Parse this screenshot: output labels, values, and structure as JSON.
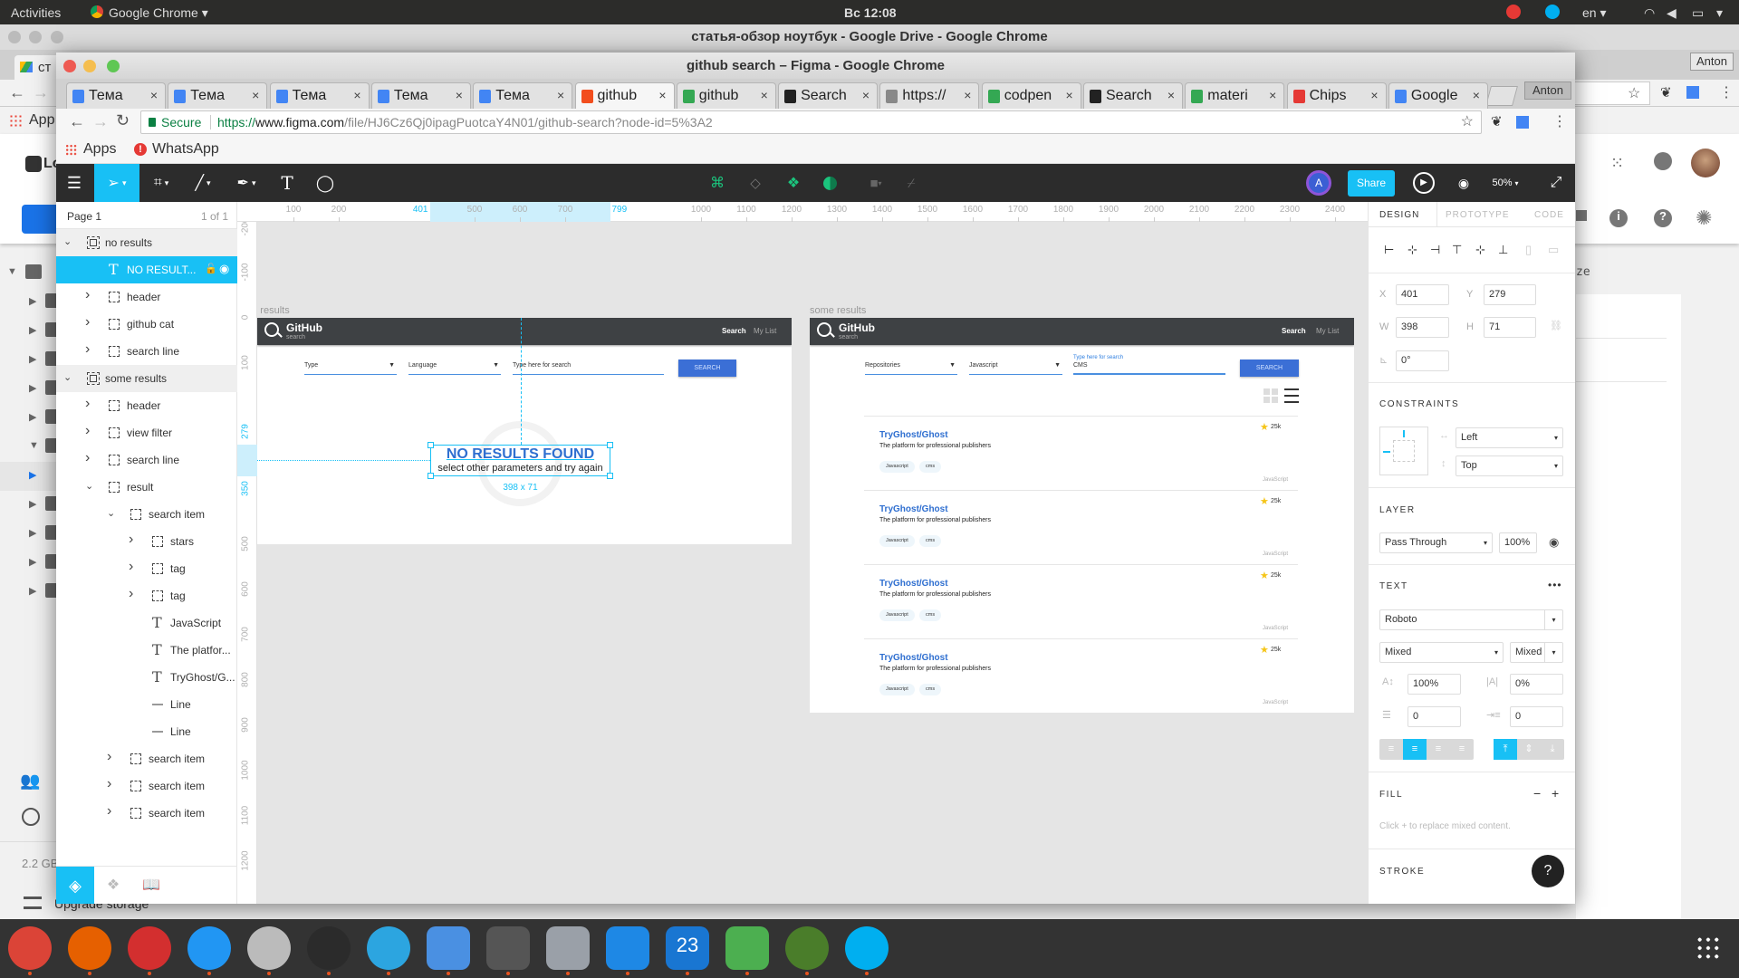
{
  "os": {
    "activities": "Activities",
    "app_menu": "Google Chrome ▾",
    "clock": "Вс 12:08",
    "lang": "en ▾"
  },
  "bg_window": {
    "title": "статья-обзор ноутбук - Google Drive - Google Chrome",
    "tab": "ст",
    "profile": "Anton",
    "apps": "App",
    "drive_logo": "Lo",
    "storage": "2.2 GB",
    "upgrade": "Upgrade storage",
    "right_label": "ze"
  },
  "window": {
    "title": "github search – Figma - Google Chrome",
    "tabs": [
      {
        "label": "Тема",
        "icon": "docs-icon",
        "color": "#4285f4"
      },
      {
        "label": "Тема",
        "icon": "docs-icon",
        "color": "#4285f4"
      },
      {
        "label": "Тема",
        "icon": "docs-icon",
        "color": "#4285f4"
      },
      {
        "label": "Тема",
        "icon": "docs-icon",
        "color": "#4285f4"
      },
      {
        "label": "Тема",
        "icon": "docs-icon",
        "color": "#4285f4"
      },
      {
        "label": "github",
        "icon": "figma-icon",
        "color": "#f24e1e",
        "active": true
      },
      {
        "label": "github",
        "icon": "google-icon",
        "color": "#34a853"
      },
      {
        "label": "Search",
        "icon": "github-icon",
        "color": "#222222"
      },
      {
        "label": "https://",
        "icon": "page-icon",
        "color": "#888888"
      },
      {
        "label": "codpen",
        "icon": "google-icon",
        "color": "#34a853"
      },
      {
        "label": "Search",
        "icon": "github-icon",
        "color": "#222222"
      },
      {
        "label": "materi",
        "icon": "google-icon",
        "color": "#34a853"
      },
      {
        "label": "Chips",
        "icon": "chips-icon",
        "color": "#e53935"
      },
      {
        "label": "Google",
        "icon": "translate-icon",
        "color": "#4285f4"
      }
    ],
    "profile": "Anton",
    "secure": "Secure",
    "url": {
      "scheme": "https://",
      "host": "www.figma.com",
      "path": "/file/HJ6Cz6Qj0ipagPuotcaY4N01/github-search?node-id=5%3A2"
    },
    "bookmarks": [
      {
        "label": "Apps"
      },
      {
        "label": "WhatsApp"
      }
    ]
  },
  "figma": {
    "toolbar": {
      "zoom": "50%",
      "share": "Share",
      "avatar": "A",
      "accent": "#18c0f5"
    },
    "page": {
      "name": "Page 1",
      "count": "1 of 1"
    },
    "layers": [
      {
        "label": "no results",
        "level": 0,
        "kind": "frame",
        "chevron": "down",
        "group": true
      },
      {
        "label": "NO RESULT...",
        "level": 1,
        "kind": "text",
        "selected": true
      },
      {
        "label": "header",
        "level": 1,
        "kind": "group",
        "chevron": "right"
      },
      {
        "label": "github cat",
        "level": 1,
        "kind": "group",
        "chevron": "right"
      },
      {
        "label": "search line",
        "level": 1,
        "kind": "group",
        "chevron": "right"
      },
      {
        "label": "some results",
        "level": 0,
        "kind": "frame",
        "chevron": "down",
        "group": true
      },
      {
        "label": "header",
        "level": 1,
        "kind": "group",
        "chevron": "right"
      },
      {
        "label": "view filter",
        "level": 1,
        "kind": "group",
        "chevron": "right"
      },
      {
        "label": "search line",
        "level": 1,
        "kind": "group",
        "chevron": "right"
      },
      {
        "label": "result",
        "level": 1,
        "kind": "group",
        "chevron": "down"
      },
      {
        "label": "search item",
        "level": 2,
        "kind": "group",
        "chevron": "down"
      },
      {
        "label": "stars",
        "level": 3,
        "kind": "group",
        "chevron": "right"
      },
      {
        "label": "tag",
        "level": 3,
        "kind": "group",
        "chevron": "right"
      },
      {
        "label": "tag",
        "level": 3,
        "kind": "group",
        "chevron": "right"
      },
      {
        "label": "JavaScript",
        "level": 3,
        "kind": "text"
      },
      {
        "label": "The platfor...",
        "level": 3,
        "kind": "text"
      },
      {
        "label": "TryGhost/G...",
        "level": 3,
        "kind": "text"
      },
      {
        "label": "Line",
        "level": 3,
        "kind": "line"
      },
      {
        "label": "Line",
        "level": 3,
        "kind": "line"
      },
      {
        "label": "search item",
        "level": 2,
        "kind": "group",
        "chevron": "right"
      },
      {
        "label": "search item",
        "level": 2,
        "kind": "group",
        "chevron": "right"
      },
      {
        "label": "search item",
        "level": 2,
        "kind": "group",
        "chevron": "right"
      }
    ],
    "rulers": {
      "h_ticks": [
        100,
        200,
        500,
        600,
        700,
        1000,
        1100,
        1200,
        1300,
        1400,
        1500,
        1600,
        1700,
        1800,
        1900,
        2000,
        2100,
        2200,
        2300,
        2400
      ],
      "h_sel": [
        401,
        799
      ],
      "v_ticks": [
        -200,
        -100,
        0,
        100,
        500,
        600,
        700,
        800,
        900,
        1000,
        1100,
        1200
      ],
      "v_sel": [
        279,
        350
      ]
    },
    "frame_no_results": {
      "label": "no results",
      "brand": "GitHub",
      "brand_sub": "search",
      "nav": [
        "Search",
        "My List"
      ],
      "filters": [
        "Type",
        "Language"
      ],
      "search_placeholder": "Type here for search",
      "button": "SEARCH",
      "empty_title": "NO RESULTS FOUND",
      "empty_subtitle": "select other parameters and try again",
      "selection_size": "398 x 71"
    },
    "frame_some_results": {
      "label": "some results",
      "brand": "GitHub",
      "brand_sub": "search",
      "nav": [
        "Search",
        "My List"
      ],
      "filters": [
        "Repositories",
        "Javascript"
      ],
      "search_label": "Type here for search",
      "search_value": "CMS",
      "button": "SEARCH",
      "results": [
        {
          "title": "TryGhost/Ghost",
          "description": "The platform for professional publishers",
          "tags": [
            "Javascript",
            "cms"
          ],
          "stars": "25k",
          "language": "JavaScript"
        },
        {
          "title": "TryGhost/Ghost",
          "description": "The platform for professional publishers",
          "tags": [
            "Javascript",
            "cms"
          ],
          "stars": "25k",
          "language": "JavaScript"
        },
        {
          "title": "TryGhost/Ghost",
          "description": "The platform for professional publishers",
          "tags": [
            "Javascript",
            "cms"
          ],
          "stars": "25k",
          "language": "JavaScript"
        },
        {
          "title": "TryGhost/Ghost",
          "description": "The platform for professional publishers",
          "tags": [
            "Javascript",
            "cms"
          ],
          "stars": "25k",
          "language": "JavaScript"
        }
      ]
    },
    "panel": {
      "tabs": [
        "DESIGN",
        "PROTOTYPE",
        "CODE"
      ],
      "x": "401",
      "y": "279",
      "w": "398",
      "h": "71",
      "rotation": "0°",
      "labels": {
        "x": "X",
        "y": "Y",
        "w": "W",
        "h": "H"
      },
      "constraints_title": "CONSTRAINTS",
      "constraint_h": "Left",
      "constraint_v": "Top",
      "layer_title": "LAYER",
      "blend": "Pass Through",
      "opacity": "100%",
      "text_title": "TEXT",
      "font": "Roboto",
      "weight": "Mixed",
      "size": "Mixed",
      "line_height": "100%",
      "letter_spacing": "0%",
      "para_spacing": "0",
      "indent": "0",
      "fill_title": "FILL",
      "fill_hint": "Click + to replace mixed content.",
      "stroke_title": "STROKE",
      "help": "?"
    }
  },
  "dock": [
    {
      "icon": "chrome-icon",
      "color": "#db4437"
    },
    {
      "icon": "firefox-icon",
      "color": "#e66000"
    },
    {
      "icon": "music-icon",
      "color": "#d32f2f"
    },
    {
      "icon": "finder-icon",
      "color": "#2196f3"
    },
    {
      "icon": "software-install-icon",
      "color": "#bbbbbb"
    },
    {
      "icon": "terminal-icon",
      "color": "#2b2b2b"
    },
    {
      "icon": "telegram-icon",
      "color": "#2ca5e0"
    },
    {
      "icon": "image-viewer-icon",
      "color": "#4a90e2"
    },
    {
      "icon": "settings-icon",
      "color": "#555555"
    },
    {
      "icon": "inkscape-icon",
      "color": "#9aa0a8"
    },
    {
      "icon": "vscode-icon",
      "color": "#1e88e5"
    },
    {
      "icon": "calendar-icon",
      "color": "#1976d2",
      "label": "23"
    },
    {
      "icon": "sublime-icon",
      "color": "#4caf50"
    },
    {
      "icon": "keepass-icon",
      "color": "#4a7d2a"
    },
    {
      "icon": "skype-icon",
      "color": "#00aff0"
    }
  ]
}
